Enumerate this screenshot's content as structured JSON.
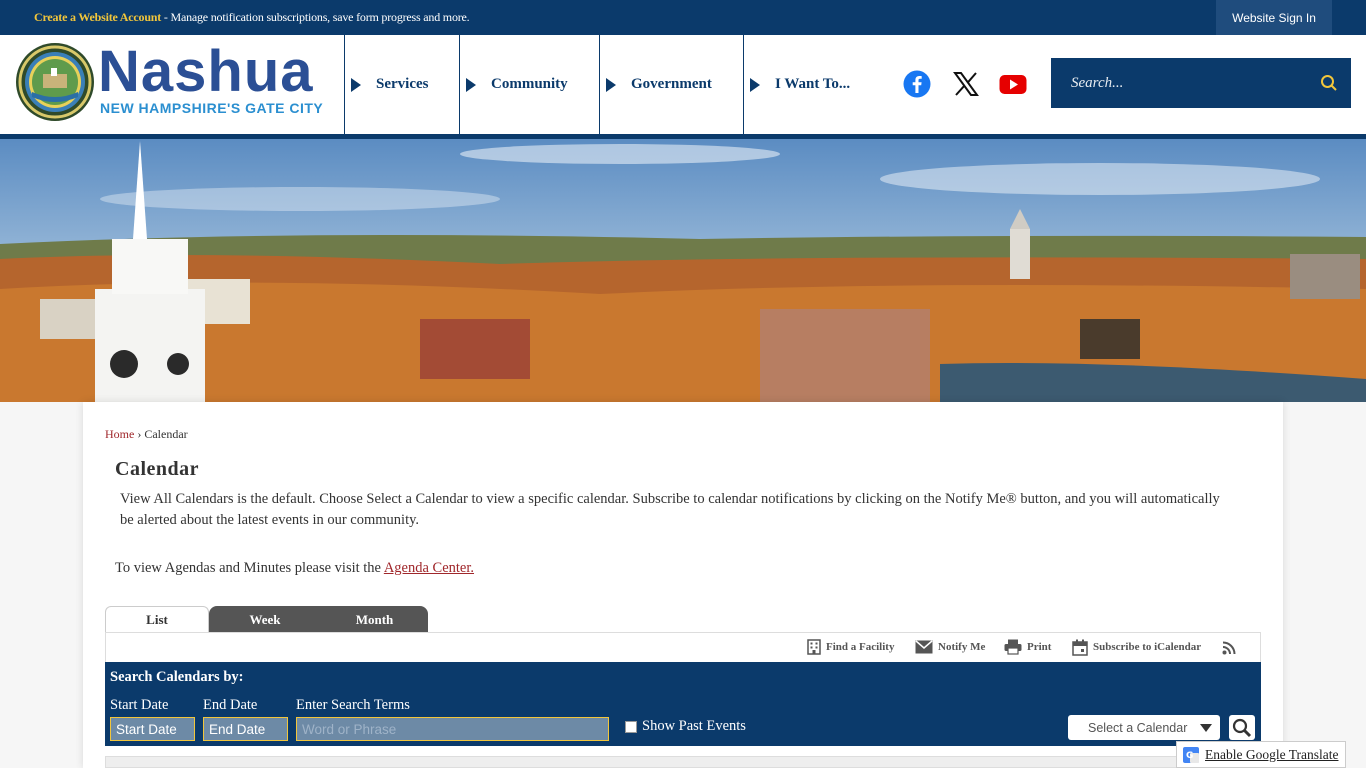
{
  "topbar": {
    "create_link": "Create a Website Account",
    "create_desc": " - Manage notification subscriptions, save form progress and more.",
    "signin": "Website Sign In"
  },
  "logo": {
    "name": "Nashua",
    "tagline": "NEW HAMPSHIRE'S GATE CITY"
  },
  "nav": {
    "items": [
      {
        "label": "Services"
      },
      {
        "label": "Community"
      },
      {
        "label": "Government"
      },
      {
        "label": "I Want To..."
      }
    ]
  },
  "social": {
    "facebook": "facebook-icon",
    "x": "x-icon",
    "youtube": "youtube-icon"
  },
  "search": {
    "placeholder": "Search..."
  },
  "breadcrumb": {
    "home": "Home",
    "sep": " › ",
    "current": "Calendar"
  },
  "page": {
    "title": "Calendar",
    "intro": "View All Calendars is the default. Choose Select a Calendar to view a specific calendar. Subscribe to calendar notifications by clicking on the Notify Me® button, and you will automatically be alerted about the latest events in our community.",
    "agenda_text": "To view Agendas and Minutes please visit the ",
    "agenda_link": "Agenda Center."
  },
  "tabs": {
    "list": "List",
    "week": "Week",
    "month": "Month"
  },
  "toolbar": {
    "find_facility": "Find a Facility",
    "notify": "Notify Me",
    "print": "Print",
    "subscribe": "Subscribe to iCalendar"
  },
  "search_panel": {
    "title": "Search Calendars by:",
    "start_label": "Start Date",
    "end_label": "End Date",
    "terms_label": "Enter Search Terms",
    "start_placeholder": "Start Date",
    "end_placeholder": "End Date",
    "terms_placeholder": "Word or Phrase",
    "past_events": "Show Past Events",
    "select_calendar": "Select a Calendar"
  },
  "google_translate": {
    "label": "Enable Google Translate"
  },
  "colors": {
    "navy": "#0b3a6b",
    "gold": "#f2c63b",
    "link_red": "#a0272b",
    "logo_blue": "#2b4f95"
  }
}
